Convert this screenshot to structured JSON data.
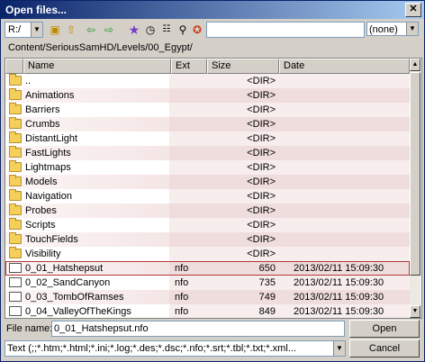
{
  "window": {
    "title": "Open files..."
  },
  "toolbar": {
    "drive": "R:/",
    "filter_value": "",
    "preset": "(none)",
    "icons": [
      "new-folder-icon",
      "up-folder-icon",
      "back-icon",
      "forward-icon",
      "star-icon",
      "history-icon",
      "list-view-icon",
      "search-icon",
      "favorite-icon"
    ]
  },
  "path": "Content/SeriousSamHD/Levels/00_Egypt/",
  "columns": [
    "Name",
    "Ext",
    "Size",
    "Date"
  ],
  "rows": [
    {
      "name": "..",
      "ext": "",
      "size": "<DIR>",
      "date": "",
      "type": "folder"
    },
    {
      "name": "Animations",
      "ext": "",
      "size": "<DIR>",
      "date": "",
      "type": "folder"
    },
    {
      "name": "Barriers",
      "ext": "",
      "size": "<DIR>",
      "date": "",
      "type": "folder"
    },
    {
      "name": "Crumbs",
      "ext": "",
      "size": "<DIR>",
      "date": "",
      "type": "folder"
    },
    {
      "name": "DistantLight",
      "ext": "",
      "size": "<DIR>",
      "date": "",
      "type": "folder"
    },
    {
      "name": "FastLights",
      "ext": "",
      "size": "<DIR>",
      "date": "",
      "type": "folder"
    },
    {
      "name": "Lightmaps",
      "ext": "",
      "size": "<DIR>",
      "date": "",
      "type": "folder"
    },
    {
      "name": "Models",
      "ext": "",
      "size": "<DIR>",
      "date": "",
      "type": "folder"
    },
    {
      "name": "Navigation",
      "ext": "",
      "size": "<DIR>",
      "date": "",
      "type": "folder"
    },
    {
      "name": "Probes",
      "ext": "",
      "size": "<DIR>",
      "date": "",
      "type": "folder"
    },
    {
      "name": "Scripts",
      "ext": "",
      "size": "<DIR>",
      "date": "",
      "type": "folder"
    },
    {
      "name": "TouchFields",
      "ext": "",
      "size": "<DIR>",
      "date": "",
      "type": "folder"
    },
    {
      "name": "Visibility",
      "ext": "",
      "size": "<DIR>",
      "date": "",
      "type": "folder"
    },
    {
      "name": "0_01_Hatshepsut",
      "ext": "nfo",
      "size": "650",
      "date": "2013/02/11 15:09:30",
      "type": "file",
      "selected": true
    },
    {
      "name": "0_02_SandCanyon",
      "ext": "nfo",
      "size": "735",
      "date": "2013/02/11 15:09:30",
      "type": "file"
    },
    {
      "name": "0_03_TombOfRamses",
      "ext": "nfo",
      "size": "749",
      "date": "2013/02/11 15:09:30",
      "type": "file"
    },
    {
      "name": "0_04_ValleyOfTheKings",
      "ext": "nfo",
      "size": "849",
      "date": "2013/02/11 15:09:30",
      "type": "file"
    }
  ],
  "footer": {
    "file_name_label": "File name:",
    "file_name_value": "0_01_Hatshepsut.nfo",
    "filter_text": "Text (;;*.htm;*.html;*.ini;*.log;*.des;*.dsc;*.nfo;*.srt;*.tbl;*.txt;*.xml...",
    "open_label": "Open",
    "cancel_label": "Cancel"
  }
}
